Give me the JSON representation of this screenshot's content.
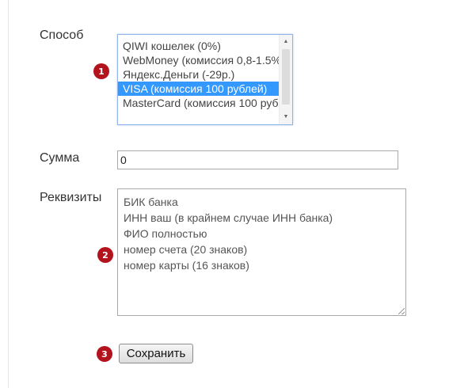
{
  "form": {
    "method_label": "Способ",
    "amount_label": "Сумма",
    "details_label": "Реквизиты",
    "amount_value": "0",
    "payment_options": [
      "QIWI кошелек (0%)",
      "WebMoney (комиссия 0,8-1.5%",
      "Яндекс.Деньги (-29р.)",
      "VISA (комиссия 100 рублей)",
      "MasterCard (комиссия 100 руб"
    ],
    "selected_option": "VISA (комиссия 100 рублей)",
    "details_placeholder": [
      "БИК банка",
      "ИНН ваш (в крайнем случае ИНН банка)",
      "ФИО полностью",
      "номер счета (20 знаков)",
      "номер карты (16 знаков)"
    ],
    "save_label": "Сохранить"
  },
  "badges": [
    "1",
    "2",
    "3"
  ],
  "colors": {
    "badge": "#b3131c",
    "selection": "#3399ff",
    "focus_border": "#8fb4e6"
  },
  "icons": [
    "scroll-up-icon",
    "scroll-down-icon",
    "resize-grip-icon"
  ]
}
